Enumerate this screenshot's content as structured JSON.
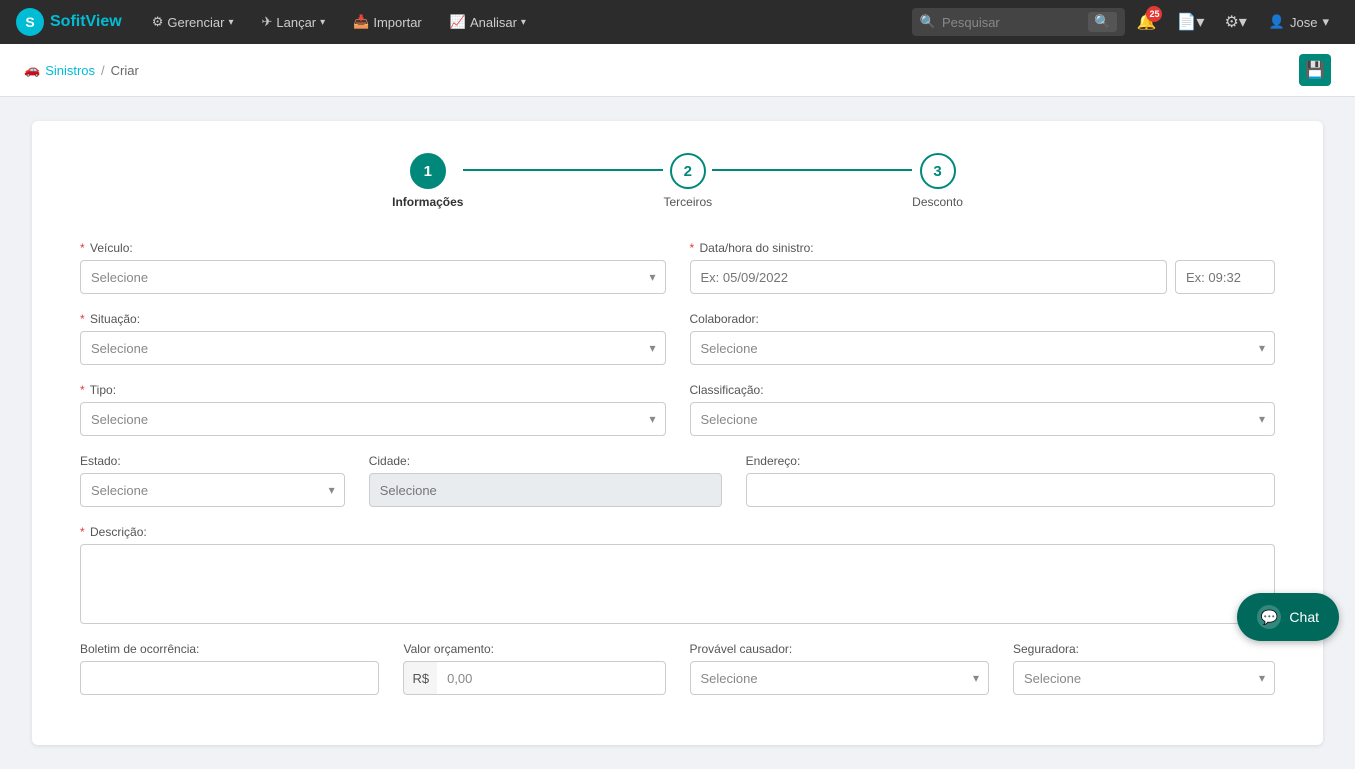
{
  "brand": {
    "logo_text": "S",
    "name_part1": "Sofit",
    "name_part2": "View"
  },
  "navbar": {
    "items": [
      {
        "label": "Gerenciar",
        "has_dropdown": true
      },
      {
        "label": "Lançar",
        "has_dropdown": true
      },
      {
        "label": "Importar",
        "has_dropdown": false
      },
      {
        "label": "Analisar",
        "has_dropdown": true
      }
    ],
    "search_placeholder": "Pesquisar",
    "notification_count": "25",
    "user_name": "Jose"
  },
  "breadcrumb": {
    "parent_icon": "🚗",
    "parent_label": "Sinistros",
    "separator": "/",
    "current": "Criar"
  },
  "stepper": {
    "steps": [
      {
        "number": "1",
        "label": "Informações",
        "active": true
      },
      {
        "number": "2",
        "label": "Terceiros",
        "active": false
      },
      {
        "number": "3",
        "label": "Desconto",
        "active": false
      }
    ]
  },
  "form": {
    "veiculo": {
      "label": "Veículo:",
      "required": true,
      "placeholder": "Selecione"
    },
    "data_hora": {
      "label": "Data/hora do sinistro:",
      "required": true,
      "date_placeholder": "Ex: 05/09/2022",
      "time_placeholder": "Ex: 09:32"
    },
    "situacao": {
      "label": "Situação:",
      "required": true,
      "placeholder": "Selecione"
    },
    "colaborador": {
      "label": "Colaborador:",
      "required": false,
      "placeholder": "Selecione"
    },
    "tipo": {
      "label": "Tipo:",
      "required": true,
      "placeholder": "Selecione"
    },
    "classificacao": {
      "label": "Classificação:",
      "required": false,
      "placeholder": "Selecione"
    },
    "estado": {
      "label": "Estado:",
      "required": false,
      "placeholder": "Selecione"
    },
    "cidade": {
      "label": "Cidade:",
      "required": false,
      "placeholder": "Selecione"
    },
    "endereco": {
      "label": "Endereço:",
      "required": false,
      "value": ""
    },
    "descricao": {
      "label": "Descrição:",
      "required": true,
      "value": ""
    },
    "boletim": {
      "label": "Boletim de ocorrência:",
      "required": false
    },
    "valor_orcamento": {
      "label": "Valor orçamento:",
      "prefix": "R$",
      "value": "0,00"
    },
    "provavel_causador": {
      "label": "Provável causador:",
      "placeholder": "Selecione"
    },
    "seguradora": {
      "label": "Seguradora:",
      "placeholder": "Selecione"
    }
  },
  "chat": {
    "label": "Chat",
    "icon": "💬"
  }
}
